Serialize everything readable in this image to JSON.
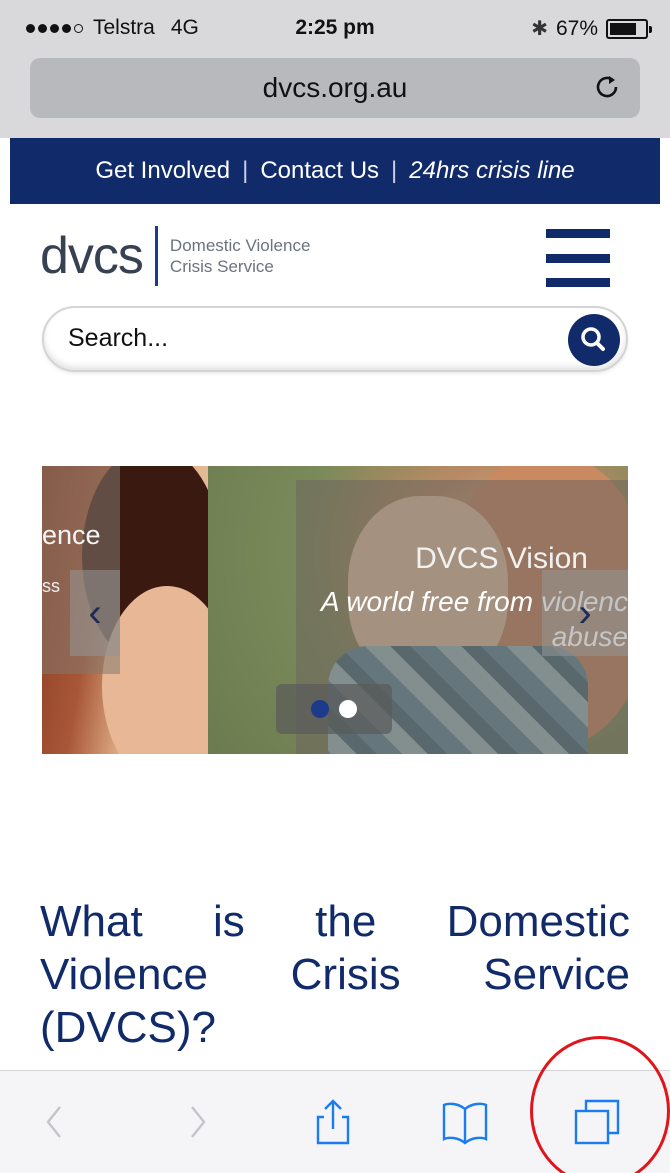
{
  "status_bar": {
    "carrier": "Telstra",
    "network": "4G",
    "time": "2:25 pm",
    "battery": "67%",
    "battery_level": 0.67
  },
  "browser": {
    "url": "dvcs.org.au"
  },
  "top_nav": {
    "items": [
      "Get Involved",
      "Contact Us",
      "24hrs crisis line"
    ],
    "separator": "|"
  },
  "logo": {
    "mark": "dvcs",
    "line1": "Domestic Violence",
    "line2": "Crisis Service"
  },
  "search": {
    "placeholder": "Search..."
  },
  "carousel": {
    "prev_caption": "lence",
    "prev_caption2": "ss",
    "title": "DVCS Vision",
    "subtitle": "A world free from violenc\nabuse",
    "slide_index": 1,
    "slide_count": 2
  },
  "main": {
    "heading": "What is the Domestic Violence Crisis Service (DVCS)?"
  },
  "toolbar": {
    "icons": [
      "back-icon",
      "forward-icon",
      "share-icon",
      "bookmarks-icon",
      "tabs-icon"
    ]
  },
  "colors": {
    "brand_navy": "#112b6a",
    "highlight_red": "#e0151b"
  }
}
